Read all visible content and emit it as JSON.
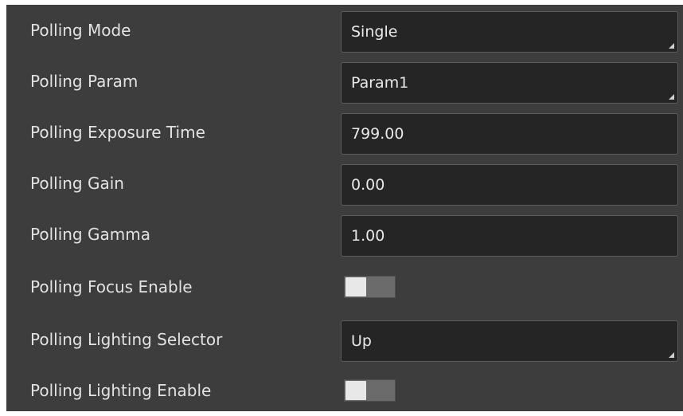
{
  "params": {
    "polling_mode": {
      "label": "Polling Mode",
      "value": "Single"
    },
    "polling_param": {
      "label": "Polling Param",
      "value": "Param1"
    },
    "polling_exposure_time": {
      "label": "Polling Exposure Time",
      "value": "799.00"
    },
    "polling_gain": {
      "label": "Polling Gain",
      "value": "0.00"
    },
    "polling_gamma": {
      "label": "Polling Gamma",
      "value": "1.00"
    },
    "polling_focus_enable": {
      "label": "Polling Focus Enable",
      "enabled": false
    },
    "polling_lighting_selector": {
      "label": "Polling Lighting Selector",
      "value": "Up"
    },
    "polling_lighting_enable": {
      "label": "Polling Lighting Enable",
      "enabled": false
    }
  },
  "colors": {
    "panel_bg": "#3d3d3d",
    "field_bg": "#252525",
    "text": "#e2e2e2"
  }
}
